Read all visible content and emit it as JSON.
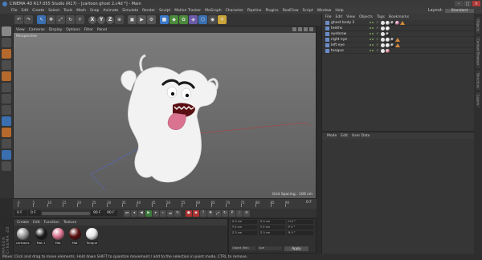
{
  "window": {
    "title": "CINEMA 4D R17.055 Studio (R17) - [cartoon ghost 2.c4d *] - Main",
    "buttons": [
      "–",
      "□",
      "×"
    ]
  },
  "menubar": {
    "items": [
      "File",
      "Edit",
      "Create",
      "Select",
      "Tools",
      "Mesh",
      "Snap",
      "Animate",
      "Simulate",
      "Render",
      "Sculpt",
      "Motion Tracker",
      "MoGraph",
      "Character",
      "Pipeline",
      "Plugins",
      "RealFlow",
      "Script",
      "Window",
      "Help"
    ],
    "layout_label": "Layout:",
    "layout_value": "Standard"
  },
  "toolbar": {
    "undo": "↶",
    "redo": "↷",
    "x": "X",
    "y": "Y",
    "z": "Z",
    "world": "⊕"
  },
  "viewport": {
    "menu": [
      "View",
      "Cameras",
      "Display",
      "Options",
      "Filter",
      "Panel"
    ],
    "camera_label": "Perspective",
    "grid_spacing": "Grid Spacing : 100 cm"
  },
  "timeline": {
    "ticks": [
      "0",
      "5",
      "10",
      "15",
      "20",
      "25",
      "30",
      "35",
      "40",
      "45",
      "50",
      "55",
      "60",
      "65",
      "70",
      "75",
      "80",
      "85",
      "90"
    ],
    "current_frame": "0 F"
  },
  "transport": {
    "start": "0 F",
    "min": "0 F",
    "max": "90 F",
    "end": "90 F"
  },
  "materials": {
    "menu": [
      "Create",
      "Edit",
      "Function",
      "Texture"
    ],
    "items": [
      {
        "label": "cartoons",
        "color": "#9a9a9a"
      },
      {
        "label": "Mat.1",
        "color": "#1e1e1e"
      },
      {
        "label": "Mat",
        "color": "#d9738f"
      },
      {
        "label": "Mat",
        "color": "#5a0f10"
      },
      {
        "label": "Tongue",
        "color": "#e8e8e8"
      }
    ]
  },
  "coordinates": {
    "rows": [
      [
        "X  0 cm",
        "X  0 cm",
        "H  0 °"
      ],
      [
        "Y  0 cm",
        "Y  0 cm",
        "P  0 °"
      ],
      [
        "Z  0 cm",
        "Z  0 cm",
        "B  0 °"
      ]
    ],
    "mode": "Object (Rel)",
    "size": "Size",
    "apply": "Apply"
  },
  "object_manager": {
    "menu": [
      "File",
      "Edit",
      "View",
      "Objects",
      "Tags",
      "Bookmarks"
    ],
    "objects": [
      {
        "name": "ghost body 2",
        "tags": [
          "#d0d0d0",
          "#222222",
          "#c86a9a"
        ]
      },
      {
        "name": "teeths",
        "tags": [
          "#e8e8e8"
        ]
      },
      {
        "name": "eyebrow",
        "tags": [
          "#202020"
        ]
      },
      {
        "name": "right eye",
        "tags": [
          "#e8e8e8",
          "#202020"
        ]
      },
      {
        "name": "left eye",
        "tags": [
          "#e8e8e8",
          "#202020"
        ]
      },
      {
        "name": "tongue",
        "tags": [
          "#c86a7a"
        ]
      }
    ]
  },
  "attribute_manager": {
    "menu": [
      "Mode",
      "Edit",
      "User Data"
    ]
  },
  "right_tabs": [
    "Objects",
    "Content Browser",
    "Structure",
    "Layers"
  ],
  "maxon_label": "MAXON CINEMA 4D",
  "status": "Move: Click and drag to move elements. Hold down SHIFT to quantize movement / add to the selection in point mode, CTRL to remove."
}
